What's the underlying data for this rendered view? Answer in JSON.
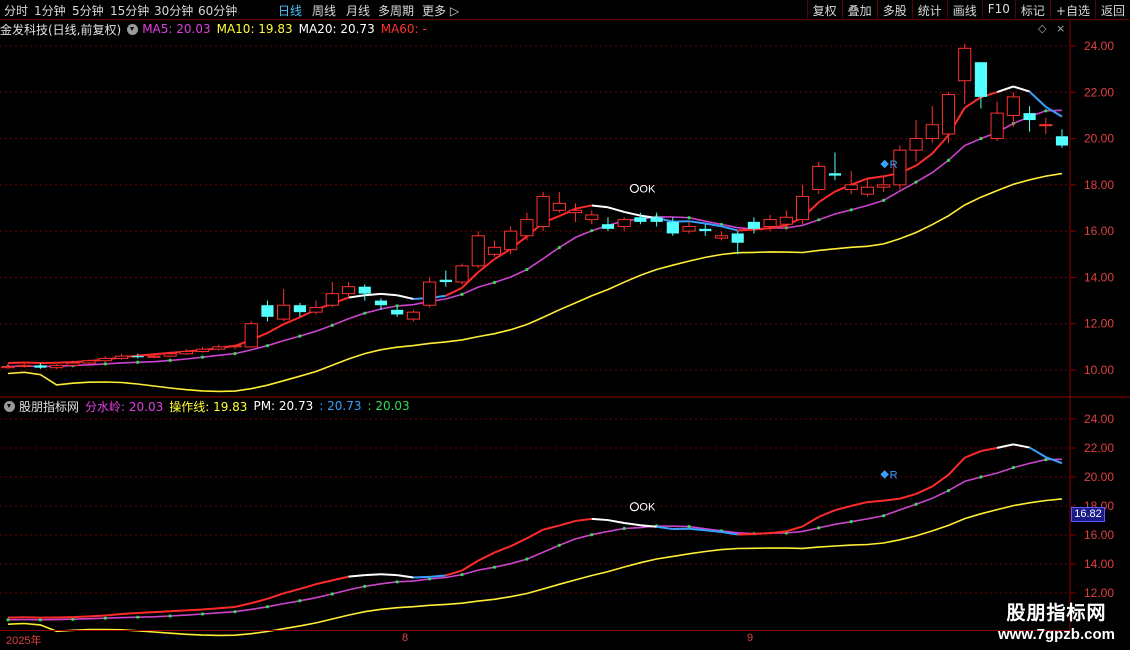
{
  "toolbar": {
    "periods": [
      "分时",
      "1分钟",
      "5分钟",
      "15分钟",
      "30分钟",
      "60分钟",
      "日线",
      "周线",
      "月线",
      "多周期",
      "更多"
    ],
    "active_period": "日线",
    "buttons": [
      "复权",
      "叠加",
      "多股",
      "统计",
      "画线",
      "F10",
      "标记",
      "+自选",
      "返回"
    ]
  },
  "main_panel": {
    "stock_label": "金发科技(日线,前复权)",
    "ma5": "MA5: 20.03",
    "ma10": "MA10: 19.83",
    "ma20": "MA20: 20.73",
    "ma60": "MA60: -",
    "colors": {
      "ma5": "#e040e0",
      "ma10": "#ffff33",
      "ma20": "#ffffff",
      "ma60": "#ff3030"
    }
  },
  "indicator_panel": {
    "name": "股朋指标网",
    "fenshuiling": "分水岭: 20.03",
    "caozuoxian": "操作线: 19.83",
    "pm": "PM: 20.73",
    "val_blue": ": 20.73",
    "val_green": ": 20.03",
    "price_tag": "16.82"
  },
  "markers": {
    "ok": "OK",
    "r": "R"
  },
  "axes": {
    "main_ticks": [
      "24.00",
      "22.00",
      "20.00",
      "18.00",
      "16.00",
      "14.00",
      "12.00",
      "10.00"
    ],
    "sub_ticks": [
      "24.00",
      "22.00",
      "20.00",
      "18.00",
      "16.00",
      "14.00",
      "12.00"
    ],
    "dates": [
      "2025年",
      "8",
      "9"
    ]
  },
  "watermark": {
    "title": "股朋指标网",
    "url": "www.7gpzb.com"
  },
  "chart_data": {
    "type": "candlestick",
    "ylim": [
      9,
      25
    ],
    "candles": [
      [
        10.1,
        10.15,
        10.25,
        10.05
      ],
      [
        10.15,
        10.2,
        10.3,
        10.1
      ],
      [
        10.2,
        10.1,
        10.3,
        10.05
      ],
      [
        10.1,
        10.2,
        10.25,
        10.05
      ],
      [
        10.2,
        10.3,
        10.4,
        10.15
      ],
      [
        10.3,
        10.4,
        10.45,
        10.2
      ],
      [
        10.4,
        10.5,
        10.6,
        10.35
      ],
      [
        10.5,
        10.6,
        10.7,
        10.45
      ],
      [
        10.6,
        10.55,
        10.7,
        10.5
      ],
      [
        10.55,
        10.6,
        10.7,
        10.5
      ],
      [
        10.6,
        10.7,
        10.8,
        10.55
      ],
      [
        10.7,
        10.8,
        10.9,
        10.65
      ],
      [
        10.8,
        10.9,
        11.0,
        10.75
      ],
      [
        10.9,
        11.0,
        11.1,
        10.85
      ],
      [
        11.0,
        11.05,
        11.1,
        10.9
      ],
      [
        11.0,
        12.0,
        12.1,
        11.9
      ],
      [
        12.8,
        12.3,
        13.0,
        12.1
      ],
      [
        12.2,
        12.8,
        13.5,
        12.1
      ],
      [
        12.8,
        12.5,
        12.9,
        12.3
      ],
      [
        12.5,
        12.7,
        13.0,
        12.4
      ],
      [
        12.8,
        13.3,
        13.8,
        12.7
      ],
      [
        13.3,
        13.6,
        13.8,
        13.1
      ],
      [
        13.6,
        13.3,
        13.7,
        13.0
      ],
      [
        13.0,
        12.8,
        13.1,
        12.6
      ],
      [
        12.6,
        12.4,
        12.7,
        12.3
      ],
      [
        12.2,
        12.5,
        12.6,
        12.1
      ],
      [
        12.8,
        13.8,
        14.0,
        12.7
      ],
      [
        13.9,
        13.8,
        14.3,
        13.6
      ],
      [
        13.8,
        14.5,
        14.6,
        13.7
      ],
      [
        14.5,
        15.8,
        16.0,
        14.4
      ],
      [
        15.0,
        15.3,
        15.6,
        14.9
      ],
      [
        15.2,
        16.0,
        16.2,
        15.0
      ],
      [
        15.8,
        16.5,
        16.8,
        15.6
      ],
      [
        16.2,
        17.5,
        17.7,
        16.0
      ],
      [
        16.9,
        17.2,
        17.7,
        16.8
      ],
      [
        16.8,
        16.9,
        17.2,
        16.4
      ],
      [
        16.5,
        16.7,
        16.9,
        16.3
      ],
      [
        16.3,
        16.1,
        16.6,
        16.0
      ],
      [
        16.2,
        16.5,
        16.6,
        16.0
      ],
      [
        16.6,
        16.4,
        16.8,
        16.3
      ],
      [
        16.6,
        16.4,
        16.8,
        16.2
      ],
      [
        16.4,
        15.9,
        16.6,
        15.8
      ],
      [
        16.0,
        16.2,
        16.4,
        15.9
      ],
      [
        16.1,
        16.0,
        16.3,
        15.8
      ],
      [
        15.7,
        15.8,
        16.0,
        15.6
      ],
      [
        15.9,
        15.5,
        16.0,
        15.0
      ],
      [
        16.4,
        16.1,
        16.6,
        15.9
      ],
      [
        16.2,
        16.5,
        16.7,
        16.0
      ],
      [
        16.3,
        16.6,
        16.9,
        16.1
      ],
      [
        16.5,
        17.5,
        18.0,
        16.3
      ],
      [
        17.8,
        18.8,
        19.0,
        17.6
      ],
      [
        18.5,
        18.4,
        19.4,
        18.2
      ],
      [
        17.8,
        18.0,
        18.6,
        17.6
      ],
      [
        17.6,
        17.9,
        18.3,
        17.5
      ],
      [
        17.9,
        18.0,
        18.4,
        17.7
      ],
      [
        18.0,
        19.5,
        19.7,
        17.8
      ],
      [
        19.5,
        20.0,
        20.8,
        19.0
      ],
      [
        20.0,
        20.6,
        21.4,
        19.8
      ],
      [
        20.2,
        21.9,
        22.0,
        19.8
      ],
      [
        22.5,
        23.9,
        24.1,
        21.5
      ],
      [
        23.3,
        21.8,
        23.3,
        21.3
      ],
      [
        20.0,
        21.1,
        21.6,
        19.9
      ],
      [
        21.0,
        21.8,
        22.0,
        20.5
      ],
      [
        21.1,
        20.8,
        21.4,
        20.3
      ],
      [
        20.6,
        20.6,
        20.9,
        20.2
      ],
      [
        20.1,
        19.7,
        20.4,
        19.6
      ]
    ]
  }
}
